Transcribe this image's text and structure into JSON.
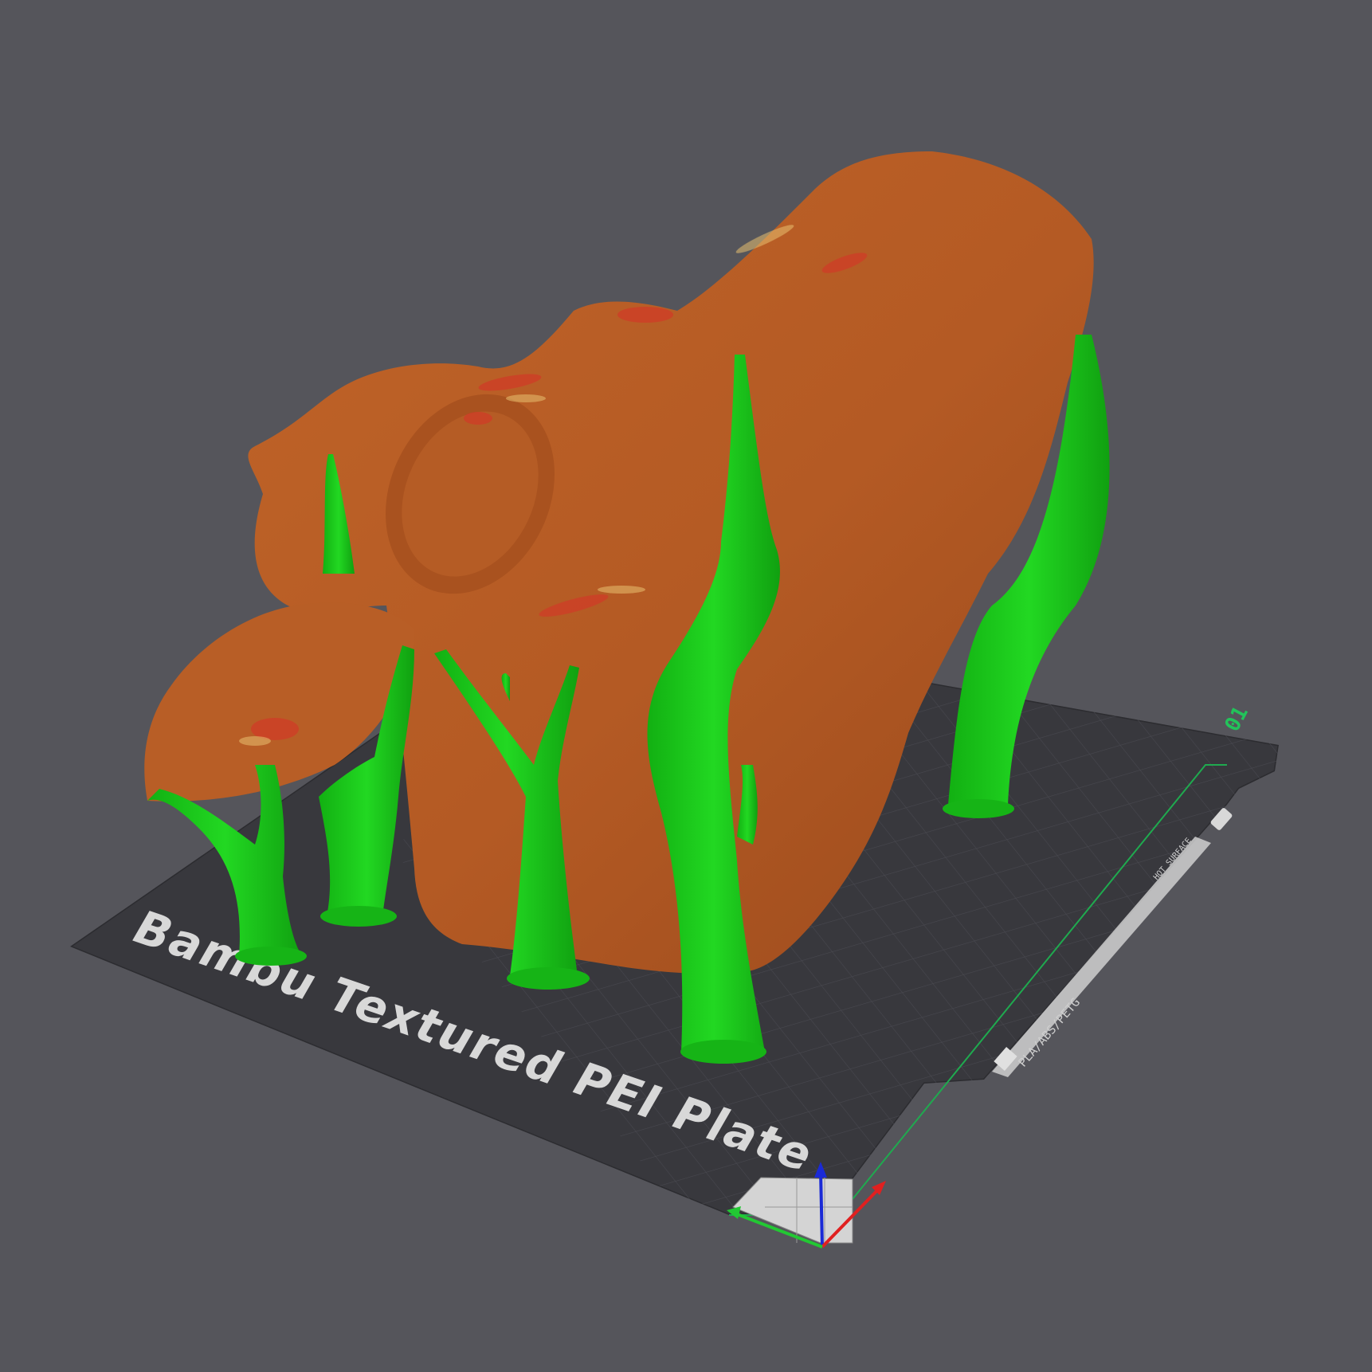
{
  "viewport": {
    "background_color": "#55555b",
    "plate": {
      "name": "Bambu Textured PEI Plate",
      "index": "01",
      "filament_label": "PLA/ABS/PETG",
      "warning_label": "HOT SURFACE",
      "plate_color": "#38383d",
      "grid_color": "#4b4b52",
      "boundary_color": "#1faa4f"
    },
    "model": {
      "object_color": "#b45a24",
      "support_color": "#1ed21e",
      "overhang_highlight_color": "#d23a28"
    },
    "axes": {
      "x_color": "#e02020",
      "y_color": "#22c833",
      "z_color": "#1a2ad6"
    }
  }
}
